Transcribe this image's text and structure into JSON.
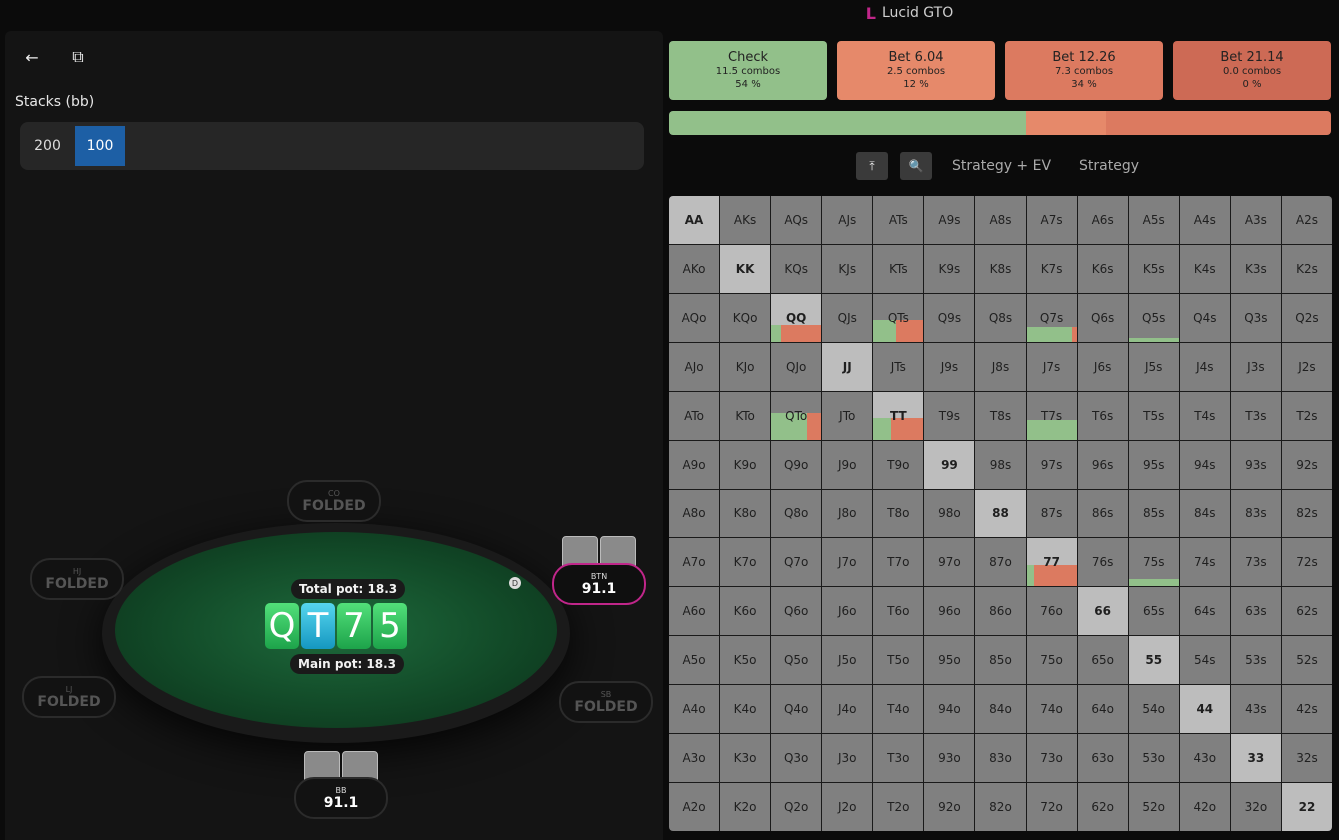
{
  "app": {
    "title": "Lucid GTO",
    "logo_icon": "L"
  },
  "toolbar": {
    "back_icon": "←",
    "share_icon": "⧉"
  },
  "stacks": {
    "label": "Stacks (bb)",
    "options": [
      "200",
      "100"
    ],
    "selected": "100"
  },
  "table": {
    "total_pot": "Total pot: 18.3",
    "main_pot": "Main pot: 18.3",
    "dealer_button": "D",
    "board": [
      "Q",
      "T",
      "7",
      "5"
    ],
    "seats": {
      "co": {
        "pos": "CO",
        "status": "FOLDED"
      },
      "hj": {
        "pos": "HJ",
        "status": "FOLDED"
      },
      "lj": {
        "pos": "LJ",
        "status": "FOLDED"
      },
      "sb": {
        "pos": "SB",
        "status": "FOLDED"
      },
      "btn": {
        "pos": "BTN",
        "stack": "91.1"
      },
      "bb": {
        "pos": "BB",
        "stack": "91.1"
      }
    }
  },
  "actions": [
    {
      "name": "Check",
      "combos": "11.5 combos",
      "pct": "54 %",
      "color": "#92c08a"
    },
    {
      "name": "Bet 6.04",
      "combos": "2.5 combos",
      "pct": "12 %",
      "color": "#e6896a"
    },
    {
      "name": "Bet 12.26",
      "combos": "7.3 combos",
      "pct": "34 %",
      "color": "#dc7a60"
    },
    {
      "name": "Bet 21.14",
      "combos": "0.0 combos",
      "pct": "0 %",
      "color": "#cd6a55"
    }
  ],
  "frequency_bar": [
    {
      "action": "Check",
      "fraction": 0.54,
      "color": "#92c08a"
    },
    {
      "action": "Bet 6.04",
      "fraction": 0.12,
      "color": "#e6896a"
    },
    {
      "action": "Bet 12.26",
      "fraction": 0.34,
      "color": "#dc7a60"
    }
  ],
  "controls": {
    "top_icon": "⤒",
    "zoom_icon": "🔍",
    "tab_strategy_ev": "Strategy + EV",
    "tab_strategy": "Strategy"
  },
  "ranks": [
    "A",
    "K",
    "Q",
    "J",
    "T",
    "9",
    "8",
    "7",
    "6",
    "5",
    "4",
    "3",
    "2"
  ],
  "highlighted_hands": {
    "QQ": [
      {
        "frac": 0.35,
        "split": [
          [
            0.2,
            "#92c08a"
          ],
          [
            0.8,
            "#dc7a60"
          ]
        ]
      }
    ],
    "QTs": [
      {
        "frac": 0.45,
        "split": [
          [
            0.45,
            "#92c08a"
          ],
          [
            0.55,
            "#dc7a60"
          ]
        ]
      }
    ],
    "Q7s": [
      {
        "frac": 0.3,
        "split": [
          [
            0.9,
            "#92c08a"
          ],
          [
            0.1,
            "#dc7a60"
          ]
        ]
      }
    ],
    "Q5s": [
      {
        "frac": 0.08,
        "split": [
          [
            1,
            "#92c08a"
          ]
        ]
      }
    ],
    "QTo": [
      {
        "frac": 0.55,
        "split": [
          [
            0.72,
            "#92c08a"
          ],
          [
            0.28,
            "#dc7a60"
          ]
        ]
      }
    ],
    "TT": [
      {
        "frac": 0.45,
        "split": [
          [
            0.35,
            "#92c08a"
          ],
          [
            0.65,
            "#dc7a60"
          ]
        ]
      }
    ],
    "T7s": [
      {
        "frac": 0.4,
        "split": [
          [
            1,
            "#92c08a"
          ]
        ]
      }
    ],
    "77": [
      {
        "frac": 0.45,
        "split": [
          [
            0.15,
            "#92c08a"
          ],
          [
            0.85,
            "#dc7a60"
          ]
        ]
      }
    ],
    "75s": [
      {
        "frac": 0.15,
        "split": [
          [
            1,
            "#92c08a"
          ]
        ]
      }
    ]
  }
}
